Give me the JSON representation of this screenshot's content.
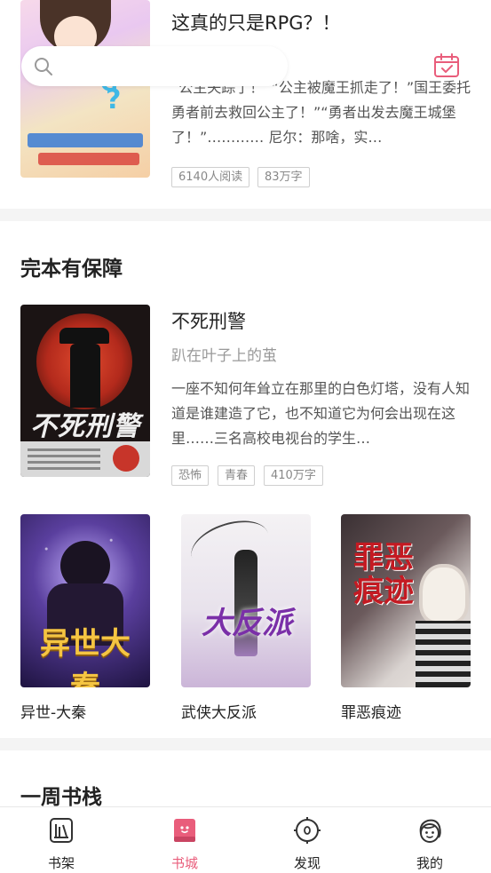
{
  "top_book": {
    "title": "这真的只是RPG？！",
    "description": "“公主失踪了！”“公主被魔王抓走了！”国王委托勇者前去救回公主了！”“勇者出发去魔王城堡了！”………… 尼尔：那啥，实…",
    "tags": [
      "6140人阅读",
      "83万字"
    ]
  },
  "search": {
    "placeholder": ""
  },
  "section_complete": {
    "title": "完本有保障",
    "featured": {
      "title": "不死刑警",
      "author": "趴在叶子上的茧",
      "description": "一座不知何年耸立在那里的白色灯塔，没有人知道是谁建造了它，也不知道它为何会出现在这里……三名高校电视台的学生…",
      "tags": [
        "恐怖",
        "青春",
        "410万字"
      ]
    },
    "grid": [
      {
        "title": "异世-大秦"
      },
      {
        "title": "武侠大反派"
      },
      {
        "title": "罪恶痕迹"
      }
    ]
  },
  "section_weekly": {
    "title": "一周书栈"
  },
  "bottom_nav": {
    "items": [
      {
        "label": "书架",
        "icon": "bookshelf-icon",
        "active": false
      },
      {
        "label": "书城",
        "icon": "bookstore-icon",
        "active": true
      },
      {
        "label": "发现",
        "icon": "compass-icon",
        "active": false
      },
      {
        "label": "我的",
        "icon": "profile-icon",
        "active": false
      }
    ],
    "active_color": "#e95d7b"
  },
  "colors": {
    "accent": "#e95d7b",
    "divider": "#f4f4f4"
  }
}
